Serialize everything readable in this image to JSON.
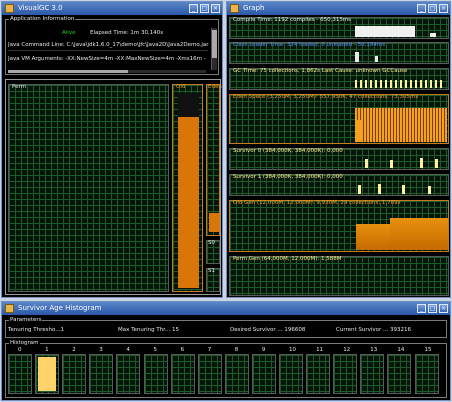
{
  "visualgc": {
    "title": "VisualGC 3.0",
    "app_info_label": "Application Information",
    "status": "Alive",
    "elapsed": "Elapsed Time:  1m 30,140s",
    "cmdline": "Java Command Line: C:\\Java\\jdk1.6.0_17\\demo\\jfc\\Java2D\\Java2Demo.jar",
    "vmargs": "Java VM Arguments: -XX:NewSize=4m -XX:MaxNewSize=4m -Xms16m -",
    "perm_label": "Perm",
    "old_label": "Old",
    "eden_label": "Eden",
    "s0_label": "S0",
    "s1_label": "S1",
    "old_fill": 0.87,
    "eden_fill": 0.13
  },
  "graph": {
    "title": "Graph",
    "panels": [
      {
        "label": "Compile Time: 1192 compiles - 650,315ms",
        "color": "#e8e8e8"
      },
      {
        "label": "Class Leader Time: 324 loaded, 0 unloaded - 50,184ms",
        "color": "#5b8cff"
      },
      {
        "label": "GC Time: 75 collections, 1,862s  Last Cause: unknown GCCause",
        "color": "#ffe98a"
      },
      {
        "label": "Eden Space (3,250M, 3,250M): 557,930K, 47 collections, 73,305ms",
        "color": "#f09a2a"
      },
      {
        "label": "Survivor 0 (384,000K, 384,000K): 0,000",
        "color": "#ffe98a"
      },
      {
        "label": "Survivor 1 (384,000K, 384,000K): 0,000",
        "color": "#ffe98a"
      },
      {
        "label": "Old Gen (12,000M, 12,000M): 9,930M, 29 collections, 1,789s",
        "color": "#f09a2a"
      },
      {
        "label": "Perm Gen (64,000M, 12,000M): 1,588M",
        "color": "#ffe98a"
      }
    ]
  },
  "histogram": {
    "title": "Survivor Age Histogram",
    "params_label": "Parameters",
    "tenuring_threshold": "Tenuring Thresho...1",
    "max_tenuring": "Max Tenuring Thr... 15",
    "desired_survivor": "Desired Survivor ... 196608",
    "current_survivor": "Current Survivor ... 393216",
    "histogram_label": "Histogram",
    "bins": [
      "0",
      "1",
      "2",
      "3",
      "4",
      "5",
      "6",
      "7",
      "8",
      "9",
      "10",
      "11",
      "12",
      "13",
      "14",
      "15"
    ],
    "bin_fills": [
      0,
      1,
      0,
      0,
      0,
      0,
      0,
      0,
      0,
      0,
      0,
      0,
      0,
      0,
      0,
      0
    ]
  },
  "window_controls": {
    "minimize": "_",
    "maximize": "□",
    "close": "×"
  },
  "colors": {
    "orange": "#d9760a",
    "grid": "#1e5a2a",
    "alive": "#22d022"
  }
}
